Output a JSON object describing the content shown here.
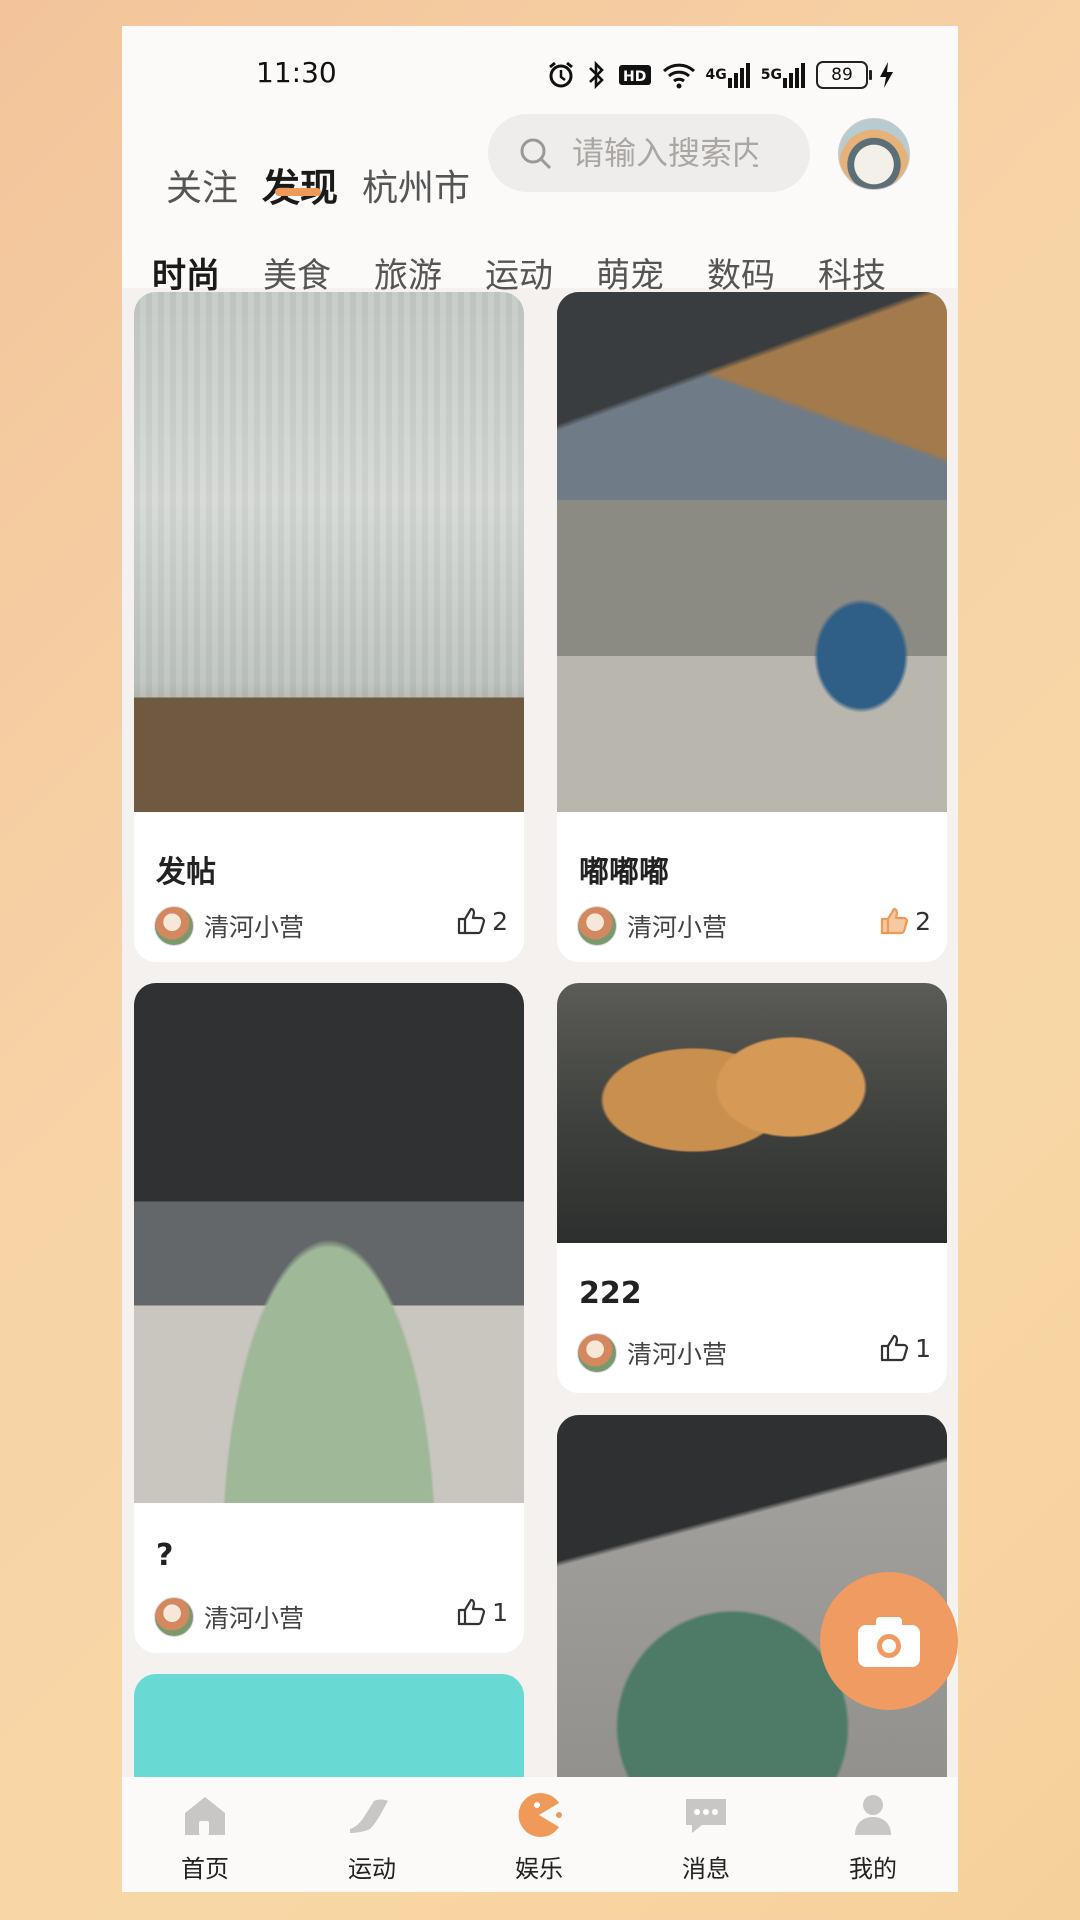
{
  "status_bar": {
    "time": "11:30",
    "battery": "89",
    "network_a": "4G",
    "network_b": "5G"
  },
  "header": {
    "tabs": [
      "关注",
      "发现",
      "杭州市"
    ],
    "active_tab": "发现",
    "search_placeholder": "请输入搜索内容"
  },
  "categories": [
    "时尚",
    "美食",
    "旅游",
    "运动",
    "萌宠",
    "数码",
    "科技"
  ],
  "active_category": "时尚",
  "posts": [
    {
      "title": "发帖",
      "user": "清河小营",
      "likes": "2",
      "liked": false,
      "image": "screen-photo"
    },
    {
      "title": "嘟嘟嘟",
      "user": "清河小营",
      "likes": "2",
      "liked": true,
      "image": "desk-photo"
    },
    {
      "title": "?",
      "user": "清河小营",
      "likes": "1",
      "liked": false,
      "image": "keyboard-photo"
    },
    {
      "title": "222",
      "user": "清河小营",
      "likes": "1",
      "liked": false,
      "image": "food-photo"
    },
    {
      "image": "coaster-photo"
    },
    {
      "image": "cyan-illustration"
    }
  ],
  "bottom_nav": [
    {
      "label": "首页",
      "icon": "home-icon"
    },
    {
      "label": "运动",
      "icon": "sneaker-icon"
    },
    {
      "label": "娱乐",
      "icon": "pacman-icon"
    },
    {
      "label": "消息",
      "icon": "message-icon"
    },
    {
      "label": "我的",
      "icon": "person-icon"
    }
  ],
  "active_nav": "娱乐",
  "colors": {
    "accent": "#ef9a59",
    "fab": "#ef9b62",
    "liked": "#ef9a59"
  }
}
